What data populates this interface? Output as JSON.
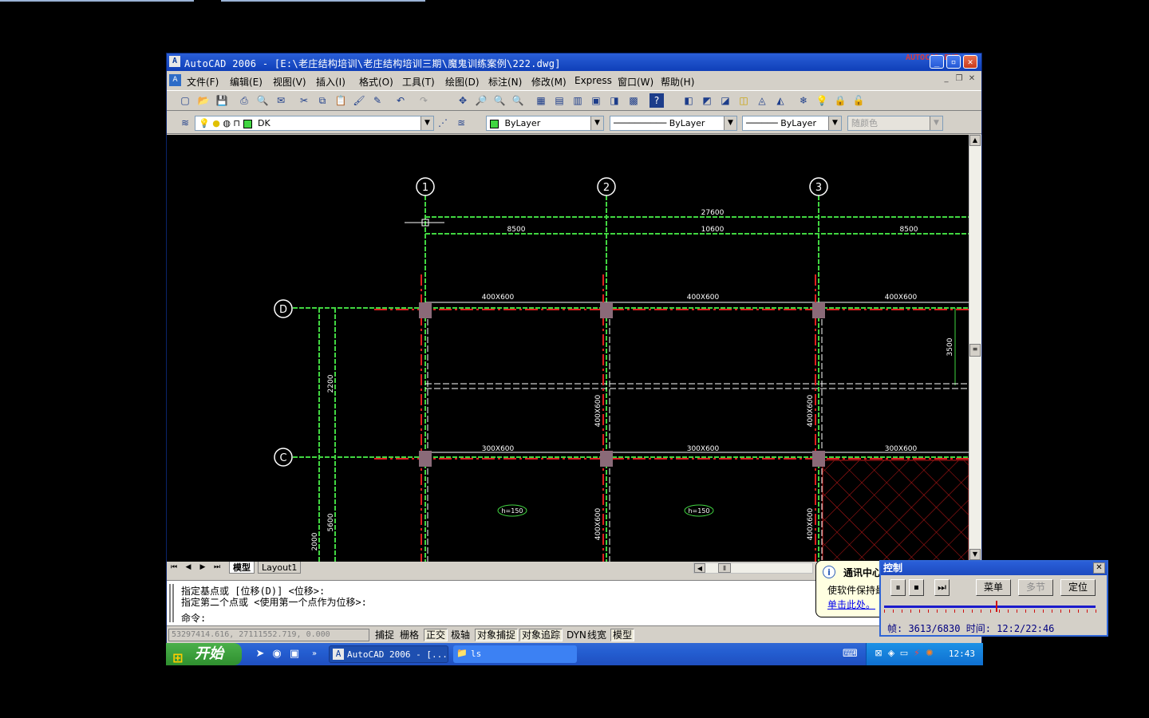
{
  "app": {
    "title": "AutoCAD 2006 - [E:\\老庄结构培训\\老庄结构培训三期\\魔鬼训练案例\\222.dwg]",
    "icon_text": "A",
    "recorder_overlay": "AUTOCAD.EXE"
  },
  "menu": {
    "items": [
      "文件(F)",
      "编辑(E)",
      "视图(V)",
      "插入(I)",
      "格式(O)",
      "工具(T)",
      "绘图(D)",
      "标注(N)",
      "修改(M)",
      "Express",
      "窗口(W)",
      "帮助(H)"
    ]
  },
  "layers": {
    "current_layer": "DK",
    "color": "ByLayer",
    "linetype": "ByLayer",
    "lineweight": "ByLayer",
    "plotstyle": "随颜色"
  },
  "drawing": {
    "grid_bubbles": [
      {
        "label": "1"
      },
      {
        "label": "2"
      },
      {
        "label": "3"
      },
      {
        "label": "D"
      },
      {
        "label": "C"
      }
    ],
    "dims": [
      "27600",
      "8500",
      "10600",
      "8500",
      "3500",
      "2200",
      "5600",
      "2000"
    ],
    "beam_labels_top": [
      "400X600",
      "400X600",
      "400X600"
    ],
    "beam_labels_mid": [
      "300X600",
      "300X600",
      "300X600"
    ],
    "column_labels": [
      "400X600",
      "400X600",
      "400X600",
      "400X600"
    ],
    "slab_labels": [
      "h=150",
      "h=150"
    ]
  },
  "tabs": {
    "model": "模型",
    "layout1": "Layout1"
  },
  "command": {
    "line1": "指定基点或 [位移(D)] <位移>:",
    "line2": "指定第二个点或 <使用第一个点作为位移>:",
    "prompt": "命令:"
  },
  "status": {
    "coords": "53297414.616, 27111552.719, 0.000",
    "buttons": [
      "捕捉",
      "栅格",
      "正交",
      "极轴",
      "对象捕捉",
      "对象追踪",
      "DYN",
      "线宽",
      "模型"
    ],
    "active_buttons": [
      "正交",
      "对象捕捉",
      "对象追踪",
      "模型"
    ]
  },
  "taskbar": {
    "start": "开始",
    "tasks": [
      {
        "label": "AutoCAD 2006 - [..."
      },
      {
        "label": "ls"
      }
    ],
    "clock": "12:43"
  },
  "balloon": {
    "title": "通讯中心",
    "message": "使软件保持最",
    "link": "单击此处。"
  },
  "control": {
    "title": "控制",
    "menu_btn": "菜单",
    "multi_btn": "多节",
    "locate_btn": "定位",
    "progress": 0.529,
    "frame_info": "帧: 3613/6830 时间: 12:2/22:46"
  },
  "colors": {
    "grid_green": "#41d641",
    "beam_red": "#e02020",
    "column_fill": "#8a6a78",
    "hatch_red": "#c01818",
    "title_blue": "#0f3fb8"
  }
}
